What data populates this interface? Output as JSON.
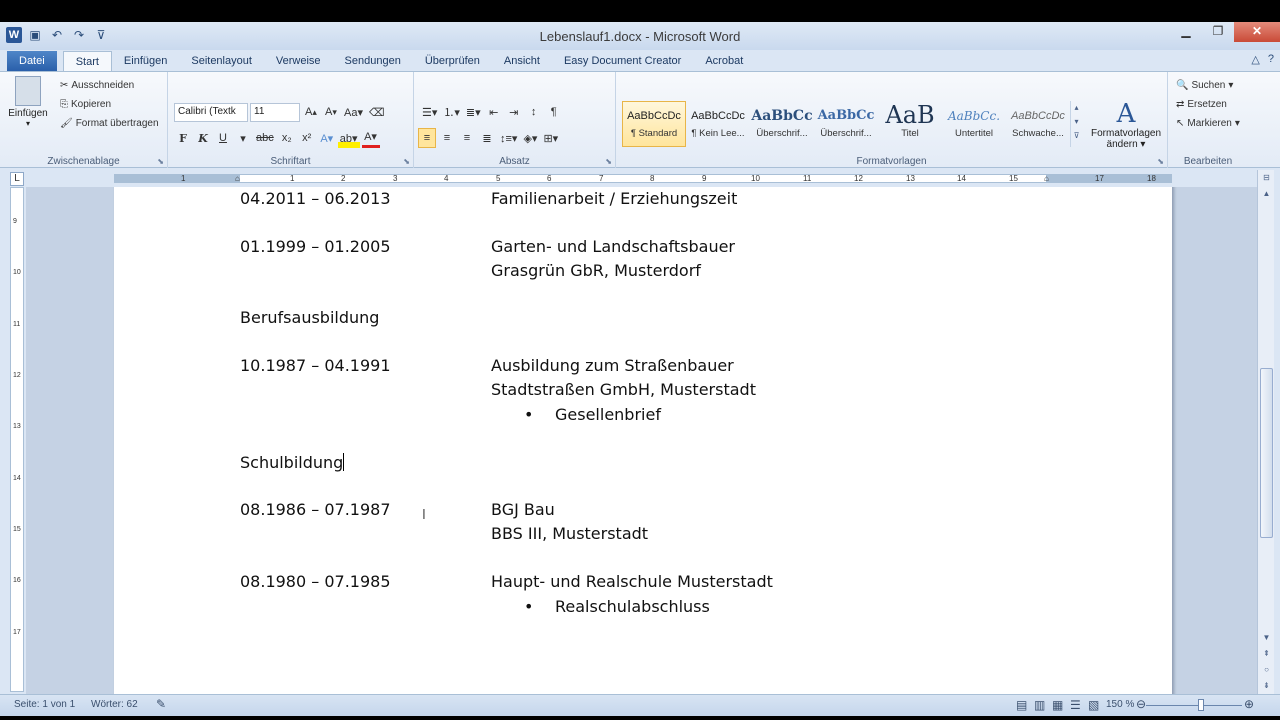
{
  "window": {
    "title": "Lebenslauf1.docx - Microsoft Word",
    "app_icon": "W"
  },
  "tabs": [
    "Datei",
    "Start",
    "Einfügen",
    "Seitenlayout",
    "Verweise",
    "Sendungen",
    "Überprüfen",
    "Ansicht",
    "Easy Document Creator",
    "Acrobat"
  ],
  "ribbon": {
    "clipboard": {
      "paste": "Einfügen",
      "cut": "Ausschneiden",
      "copy": "Kopieren",
      "format_painter": "Format übertragen",
      "label": "Zwischenablage"
    },
    "font": {
      "name": "Calibri (Textk",
      "size": "11",
      "label": "Schriftart",
      "bold": "F",
      "italic": "K",
      "underline": "U"
    },
    "paragraph": {
      "label": "Absatz"
    },
    "styles": {
      "label": "Formatvorlagen",
      "items": [
        {
          "preview": "AaBbCcDc",
          "name": "¶ Standard"
        },
        {
          "preview": "AaBbCcDc",
          "name": "¶ Kein Lee..."
        },
        {
          "preview": "AaBbCc",
          "name": "Überschrif..."
        },
        {
          "preview": "AaBbCc",
          "name": "Überschrif..."
        },
        {
          "preview": "AaB",
          "name": "Titel"
        },
        {
          "preview": "AaBbCc.",
          "name": "Untertitel"
        },
        {
          "preview": "AaBbCcDc",
          "name": "Schwache..."
        }
      ],
      "change_line1": "Formatvorlagen",
      "change_line2": "ändern"
    },
    "editing": {
      "find": "Suchen",
      "replace": "Ersetzen",
      "select": "Markieren",
      "label": "Bearbeiten"
    }
  },
  "document": {
    "lines": [
      {
        "left": "04.2011 – 06.2013",
        "right": "Familienarbeit / Erziehungszeit"
      },
      {
        "left": "01.1999 – 01.2005",
        "right": "Garten- und Landschaftsbauer"
      },
      {
        "left": "",
        "right": "Grasgrün GbR, Musterdorf"
      },
      {
        "left": "Berufsausbildung",
        "right": ""
      },
      {
        "left": "10.1987 – 04.1991",
        "right": "Ausbildung zum Straßenbauer"
      },
      {
        "left": "",
        "right": "Stadtstraßen GmbH, Musterstadt"
      },
      {
        "bullet": "Gesellenbrief"
      },
      {
        "left": "Schulbildung",
        "right": ""
      },
      {
        "left": "08.1986 – 07.1987",
        "right": "BGJ Bau"
      },
      {
        "left": "",
        "right": "BBS III, Musterstadt"
      },
      {
        "left": "08.1980 – 07.1985",
        "right": "Haupt- und Realschule Musterstadt"
      },
      {
        "bullet": "Realschulabschluss"
      }
    ]
  },
  "statusbar": {
    "page": "Seite: 1 von 1",
    "words": "Wörter: 62",
    "zoom": "150 %"
  }
}
